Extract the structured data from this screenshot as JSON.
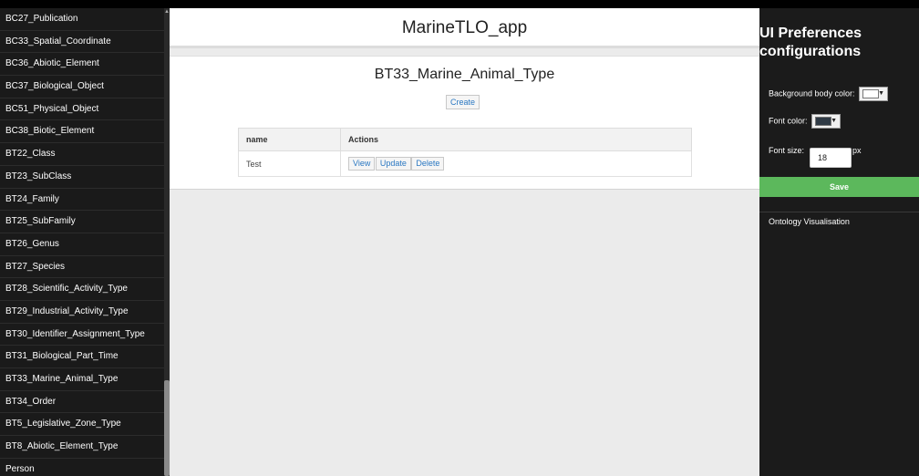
{
  "sidebar": {
    "items": [
      "BC27_Publication",
      "BC33_Spatial_Coordinate",
      "BC36_Abiotic_Element",
      "BC37_Biological_Object",
      "BC51_Physical_Object",
      "BC38_Biotic_Element",
      "BT22_Class",
      "BT23_SubClass",
      "BT24_Family",
      "BT25_SubFamily",
      "BT26_Genus",
      "BT27_Species",
      "BT28_Scientific_Activity_Type",
      "BT29_Industrial_Activity_Type",
      "BT30_Identifier_Assignment_Type",
      "BT31_Biological_Part_Time",
      "BT33_Marine_Animal_Type",
      "BT34_Order",
      "BT5_Legislative_Zone_Type",
      "BT8_Abiotic_Element_Type",
      "Person"
    ]
  },
  "header": {
    "title": "MarineTLO_app"
  },
  "panel": {
    "title": "BT33_Marine_Animal_Type",
    "create_label": "Create",
    "table": {
      "columns": [
        "name",
        "Actions"
      ],
      "rows": [
        {
          "name": "Test",
          "actions": [
            "View",
            "Update",
            "Delete"
          ]
        }
      ]
    }
  },
  "prefs": {
    "title": "UI Preferences configurations",
    "bg_label": "Background body color:",
    "bg_color": "#ffffff",
    "font_color_label": "Font color:",
    "font_color": "#2f3a45",
    "font_size_label": "Font size:",
    "font_size_value": "18",
    "font_size_unit": "px",
    "save_label": "Save",
    "ontology_link": "Ontology Visualisation"
  },
  "icons": {
    "caret": "caret-down-icon",
    "scroll_up": "scroll-up-arrow-icon"
  }
}
